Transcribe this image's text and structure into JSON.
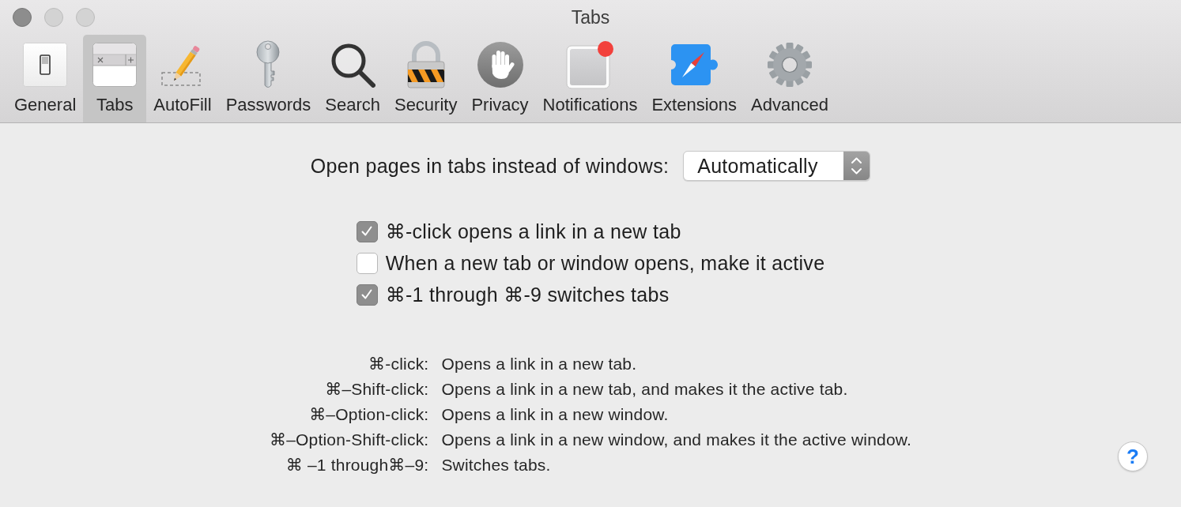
{
  "window": {
    "title": "Tabs"
  },
  "toolbar": {
    "items": [
      {
        "label": "General",
        "selected": false
      },
      {
        "label": "Tabs",
        "selected": true
      },
      {
        "label": "AutoFill",
        "selected": false
      },
      {
        "label": "Passwords",
        "selected": false
      },
      {
        "label": "Search",
        "selected": false
      },
      {
        "label": "Security",
        "selected": false
      },
      {
        "label": "Privacy",
        "selected": false
      },
      {
        "label": "Notifications",
        "selected": false
      },
      {
        "label": "Extensions",
        "selected": false
      },
      {
        "label": "Advanced",
        "selected": false
      }
    ]
  },
  "open_pages": {
    "label": "Open pages in tabs instead of windows:",
    "value": "Automatically"
  },
  "checkboxes": [
    {
      "label": "⌘-click opens a link in a new tab",
      "checked": true
    },
    {
      "label": "When a new tab or window opens, make it active",
      "checked": false
    },
    {
      "label": "⌘-1 through ⌘-9 switches tabs",
      "checked": true
    }
  ],
  "shortcuts": [
    {
      "keys": "⌘-click:",
      "description": "Opens a link in a new tab."
    },
    {
      "keys": "⌘–Shift-click:",
      "description": "Opens a link in a new tab, and makes it the active tab."
    },
    {
      "keys": "⌘–Option-click:",
      "description": "Opens a link in a new window."
    },
    {
      "keys": "⌘–Option-Shift-click:",
      "description": "Opens a link in a new window, and makes it the active window."
    },
    {
      "keys": "⌘ –1 through⌘–9:",
      "description": "Switches tabs."
    }
  ],
  "help_button": {
    "label": "?"
  }
}
